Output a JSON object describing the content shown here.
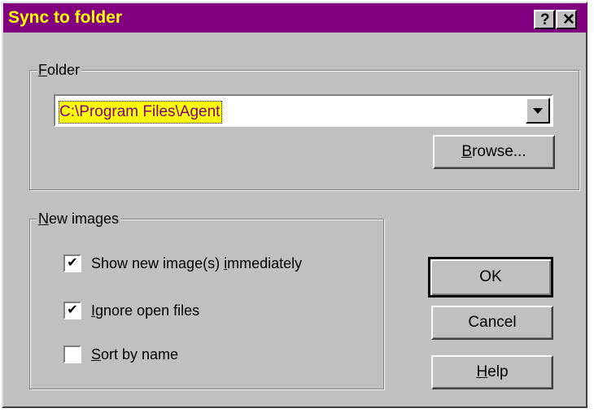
{
  "window": {
    "title": "Sync to folder",
    "help_glyph": "?",
    "close_glyph": "✕",
    "title_bg": "#800080",
    "title_fg": "#ffff00"
  },
  "folder_group": {
    "legend_first": "F",
    "legend_rest": "older",
    "path_value": "C:\\Program Files\\Agent",
    "browse_first": "B",
    "browse_rest": "rowse..."
  },
  "new_images_group": {
    "legend_first": "N",
    "legend_rest": "ew images",
    "options": [
      {
        "pre": "Show new image(s) ",
        "ul": "i",
        "post": "mmediately",
        "checked": true
      },
      {
        "pre": "",
        "ul": "I",
        "post": "gnore open files",
        "checked": true
      },
      {
        "pre": "",
        "ul": "S",
        "post": "ort by name",
        "checked": false
      }
    ]
  },
  "buttons": {
    "ok": "OK",
    "cancel": "Cancel",
    "help_first": "H",
    "help_rest": "elp"
  },
  "colors": {
    "dialog_face": "#c0c0c0",
    "selection_bg": "#ffff00",
    "selection_fg": "#800080"
  }
}
